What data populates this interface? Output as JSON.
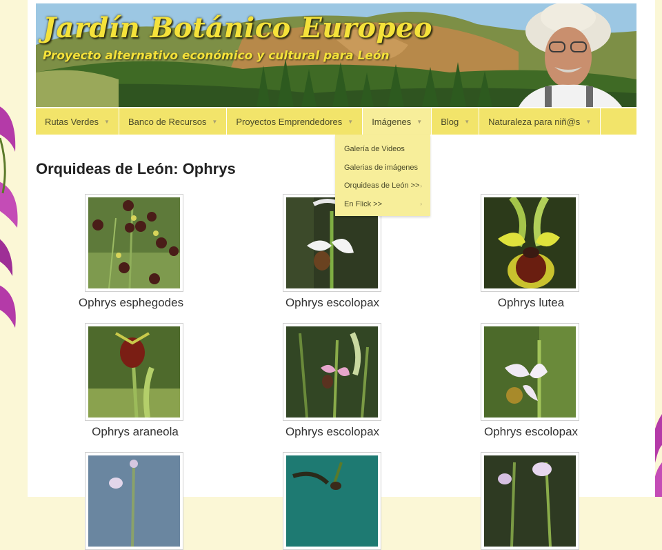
{
  "site": {
    "title": "Jardín Botánico Europeo",
    "subtitle": "Proyecto alternativo económico y cultural para León"
  },
  "nav": {
    "items": [
      {
        "label": "Rutas Verdes"
      },
      {
        "label": "Banco de Recursos"
      },
      {
        "label": "Proyectos Emprendedores"
      },
      {
        "label": "Imágenes"
      },
      {
        "label": "Blog"
      },
      {
        "label": "Naturaleza para niñ@s"
      }
    ],
    "active_index": 3,
    "dropdown": [
      {
        "label": "Galería de Videos",
        "arrow": ""
      },
      {
        "label": "Galerias de imágenes",
        "arrow": ""
      },
      {
        "label": "Orquideas de León >>",
        "arrow": "›"
      },
      {
        "label": "En Flick >>",
        "arrow": "›"
      }
    ]
  },
  "page": {
    "title": "Orquideas de León: Ophrys"
  },
  "gallery": [
    {
      "caption": "Ophrys esphegodes"
    },
    {
      "caption": "Ophrys escolopax"
    },
    {
      "caption": "Ophrys lutea"
    },
    {
      "caption": "Ophrys araneola"
    },
    {
      "caption": "Ophrys escolopax"
    },
    {
      "caption": "Ophrys escolopax"
    },
    {
      "caption": ""
    },
    {
      "caption": ""
    },
    {
      "caption": ""
    }
  ],
  "colors": {
    "nav_bg": "#f2e46a",
    "title_yellow": "#f5e23a",
    "page_bg": "#fbf7d6"
  }
}
